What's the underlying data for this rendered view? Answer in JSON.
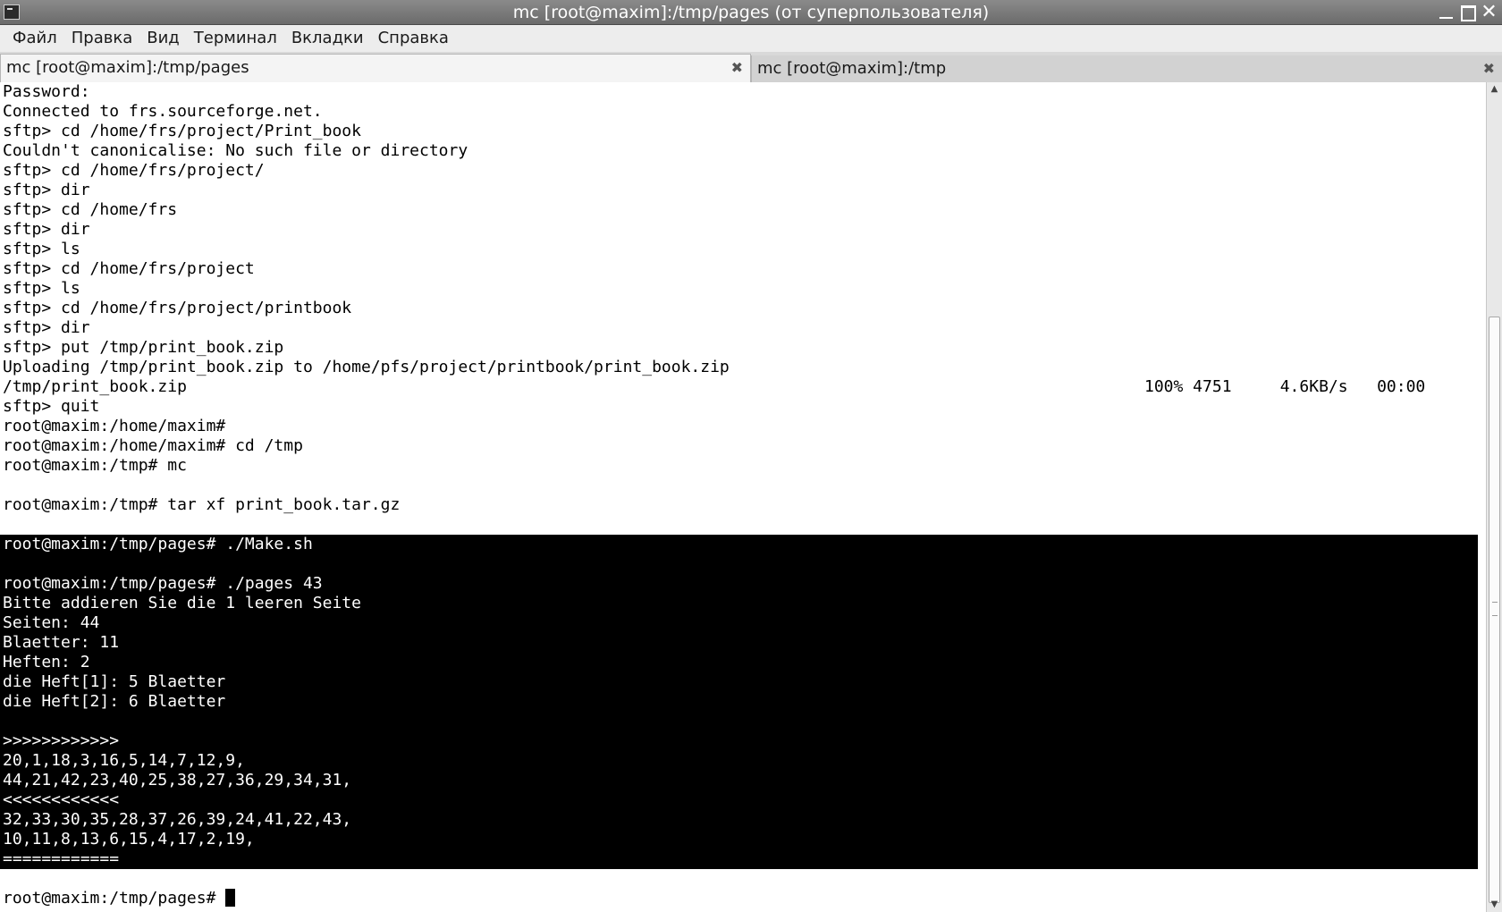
{
  "window": {
    "title": "mc [root@maxim]:/tmp/pages (от суперпользователя)"
  },
  "menu": {
    "items": [
      "Файл",
      "Правка",
      "Вид",
      "Терминал",
      "Вкладки",
      "Справка"
    ]
  },
  "tabs": [
    {
      "label": "mc [root@maxim]:/tmp/pages",
      "active": true
    },
    {
      "label": "mc [root@maxim]:/tmp",
      "active": false
    }
  ],
  "terminal": {
    "lines": [
      "Password:",
      "Connected to frs.sourceforge.net.",
      "sftp> cd /home/frs/project/Print_book",
      "Couldn't canonicalise: No such file or directory",
      "sftp> cd /home/frs/project/",
      "sftp> dir",
      "sftp> cd /home/frs",
      "sftp> dir",
      "sftp> ls",
      "sftp> cd /home/frs/project",
      "sftp> ls",
      "sftp> cd /home/frs/project/printbook",
      "sftp> dir",
      "sftp> put /tmp/print_book.zip",
      "Uploading /tmp/print_book.zip to /home/pfs/project/printbook/print_book.zip",
      "/tmp/print_book.zip",
      "sftp> quit",
      "root@maxim:/home/maxim#",
      "root@maxim:/home/maxim# cd /tmp",
      "root@maxim:/tmp# mc",
      "",
      "root@maxim:/tmp# tar xf print_book.tar.gz",
      ""
    ],
    "progress": "100% 4751     4.6KB/s   00:00",
    "inverse_lines": [
      "root@maxim:/tmp/pages# ./Make.sh",
      "",
      "root@maxim:/tmp/pages# ./pages 43",
      "Bitte addieren Sie die 1 leeren Seite",
      "Seiten: 44",
      "Blaetter: 11",
      "Heften: 2",
      "die Heft[1]: 5 Blaetter",
      "die Heft[2]: 6 Blaetter",
      "",
      ">>>>>>>>>>>>",
      "20,1,18,3,16,5,14,7,12,9,",
      "44,21,42,23,40,25,38,27,36,29,34,31,",
      "<<<<<<<<<<<<",
      "32,33,30,35,28,37,26,39,24,41,22,43,",
      "10,11,8,13,6,15,4,17,2,19,",
      "============"
    ],
    "prompt": "root@maxim:/tmp/pages# "
  },
  "icons": {
    "app": "terminal-app-icon",
    "minimize": "minimize-icon",
    "maximize": "maximize-icon",
    "close": "close-icon",
    "tab_close": "tab-close-icon"
  }
}
